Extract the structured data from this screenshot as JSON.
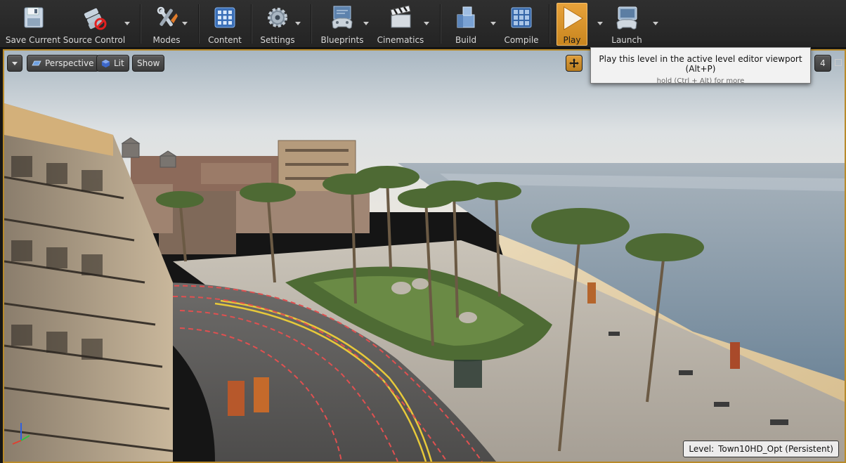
{
  "toolbar": {
    "buttons": [
      {
        "label": "Save Current",
        "icon": "floppy-disk-icon",
        "has_dropdown": false
      },
      {
        "label": "Source Control",
        "icon": "source-control-icon",
        "has_dropdown": true
      },
      {
        "label": "Modes",
        "icon": "modes-tools-icon",
        "has_dropdown": true
      },
      {
        "label": "Content",
        "icon": "content-grid-icon",
        "has_dropdown": false
      },
      {
        "label": "Settings",
        "icon": "settings-gear-icon",
        "has_dropdown": true
      },
      {
        "label": "Blueprints",
        "icon": "blueprint-gamepad-icon",
        "has_dropdown": true
      },
      {
        "label": "Cinematics",
        "icon": "clapperboard-icon",
        "has_dropdown": true
      },
      {
        "label": "Build",
        "icon": "build-blocks-icon",
        "has_dropdown": true
      },
      {
        "label": "Compile",
        "icon": "compile-cubes-icon",
        "has_dropdown": false
      },
      {
        "label": "Play",
        "icon": "play-triangle-icon",
        "has_dropdown": true,
        "active": true
      },
      {
        "label": "Launch",
        "icon": "launch-gamepad-icon",
        "has_dropdown": true
      }
    ]
  },
  "viewport": {
    "view_mode": "Perspective",
    "lighting_mode": "Lit",
    "show_label": "Show",
    "camera_speed": "4",
    "level_label": "Level:",
    "level_name": "Town10HD_Opt (Persistent)",
    "border_color": "#b88a2a"
  },
  "tooltip": {
    "title": "Play this level in the active level editor viewport (Alt+P)",
    "hint": "hold (Ctrl + Alt) for more"
  },
  "colors": {
    "toolbar_bg": "#2b2b2b",
    "play_accent": "#e8a23a",
    "sky": "#d9dde0",
    "sea": "#7f93a3",
    "sand": "#e2cfaa"
  }
}
